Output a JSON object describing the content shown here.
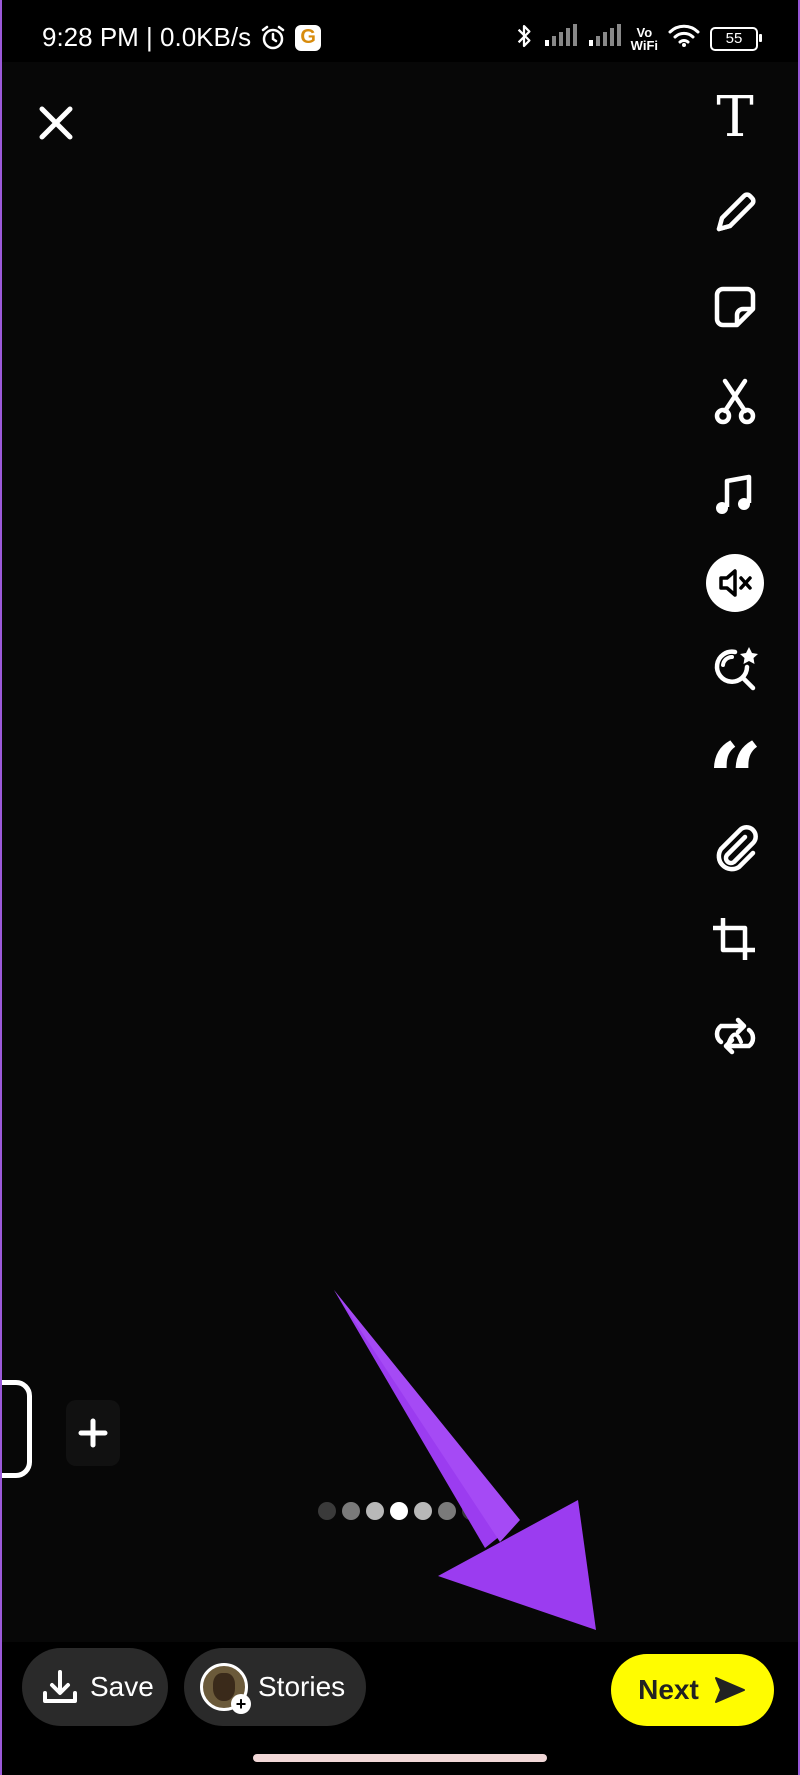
{
  "status_bar": {
    "time_speed": "9:28 PM | 0.0KB/s",
    "g_badge": "G",
    "vowifi_top": "Vo",
    "vowifi_bottom": "WiFi",
    "battery": "55",
    "icons": [
      "alarm-icon",
      "google-icon",
      "bluetooth-icon",
      "signal-icon",
      "signal-icon",
      "wifi-icon",
      "battery-icon"
    ]
  },
  "editor": {
    "close_icon": "close-icon",
    "toolbar": [
      {
        "name": "text-tool",
        "icon": "text-icon",
        "glyph": "T"
      },
      {
        "name": "draw-tool",
        "icon": "pencil-icon"
      },
      {
        "name": "sticker-tool",
        "icon": "sticker-icon"
      },
      {
        "name": "scissors-tool",
        "icon": "scissors-icon"
      },
      {
        "name": "music-tool",
        "icon": "music-note-icon"
      },
      {
        "name": "mute-tool",
        "icon": "speaker-muted-icon"
      },
      {
        "name": "lens-tool",
        "icon": "lens-search-icon"
      },
      {
        "name": "quote-tool",
        "icon": "quote-icon",
        "glyph": "“"
      },
      {
        "name": "attach-tool",
        "icon": "paperclip-icon"
      },
      {
        "name": "crop-tool",
        "icon": "crop-icon"
      },
      {
        "name": "loop-tool",
        "icon": "loop-icon"
      }
    ],
    "page_dots": {
      "count": 7,
      "active_index": 3
    }
  },
  "bottom": {
    "save_label": "Save",
    "stories_label": "Stories",
    "next_label": "Next"
  },
  "colors": {
    "background": "#070707",
    "next_button": "#fffc00",
    "pill_bg": "#2a2a2a",
    "annotation_arrow": "#9b3cf0"
  }
}
